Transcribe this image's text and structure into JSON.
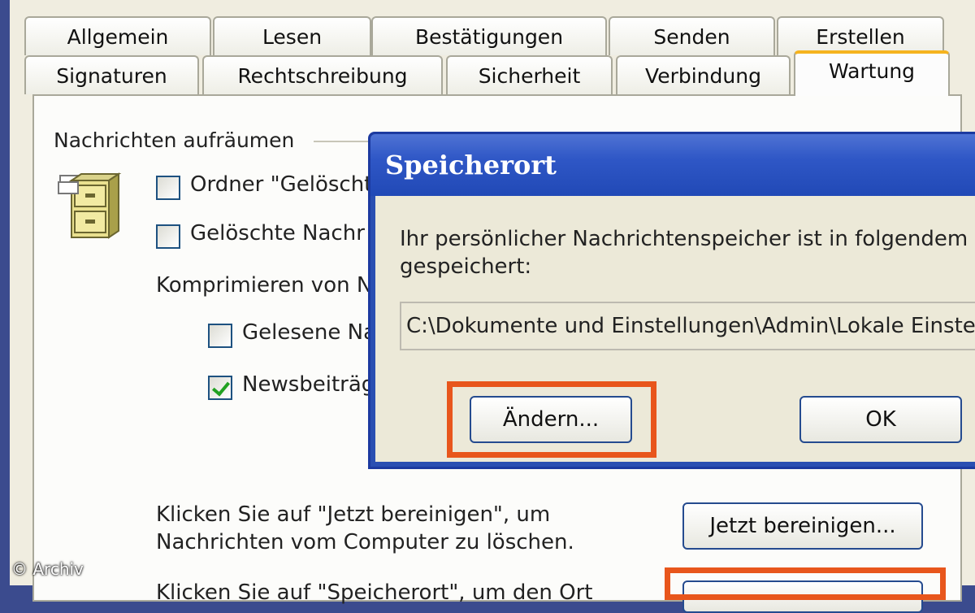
{
  "tabs_row1": [
    "Allgemein",
    "Lesen",
    "Bestätigungen",
    "Senden",
    "Erstellen"
  ],
  "tabs_row2": [
    "Signaturen",
    "Rechtschreibung",
    "Sicherheit",
    "Verbindung",
    "Wartung"
  ],
  "active_tab": "Wartung",
  "group": {
    "title": "Nachrichten aufräumen",
    "option1": "Ordner \"Gelöscht",
    "option2": "Gelöschte Nachr",
    "compress_label": "Komprimieren von Na",
    "sub_option1": "Gelesene Na",
    "sub_option2": "Newsbeiträg",
    "sub_option2_checked": true
  },
  "cleanup": {
    "text_line1": "Klicken Sie auf \"Jetzt bereinigen\", um",
    "text_line2": "Nachrichten vom Computer zu löschen.",
    "button": "Jetzt bereinigen...",
    "partial_line": "Klicken Sie auf \"Speicherort\", um den Ort"
  },
  "dialog": {
    "title": "Speicherort",
    "message_line1": "Ihr persönlicher Nachrichtenspeicher ist in folgendem O",
    "message_line2": "gespeichert:",
    "path": "C:\\Dokumente und Einstellungen\\Admin\\Lokale Einste",
    "change_button": "Ändern...",
    "ok_button": "OK"
  },
  "highlight_color": "#e8561c",
  "credit": "© Archiv"
}
